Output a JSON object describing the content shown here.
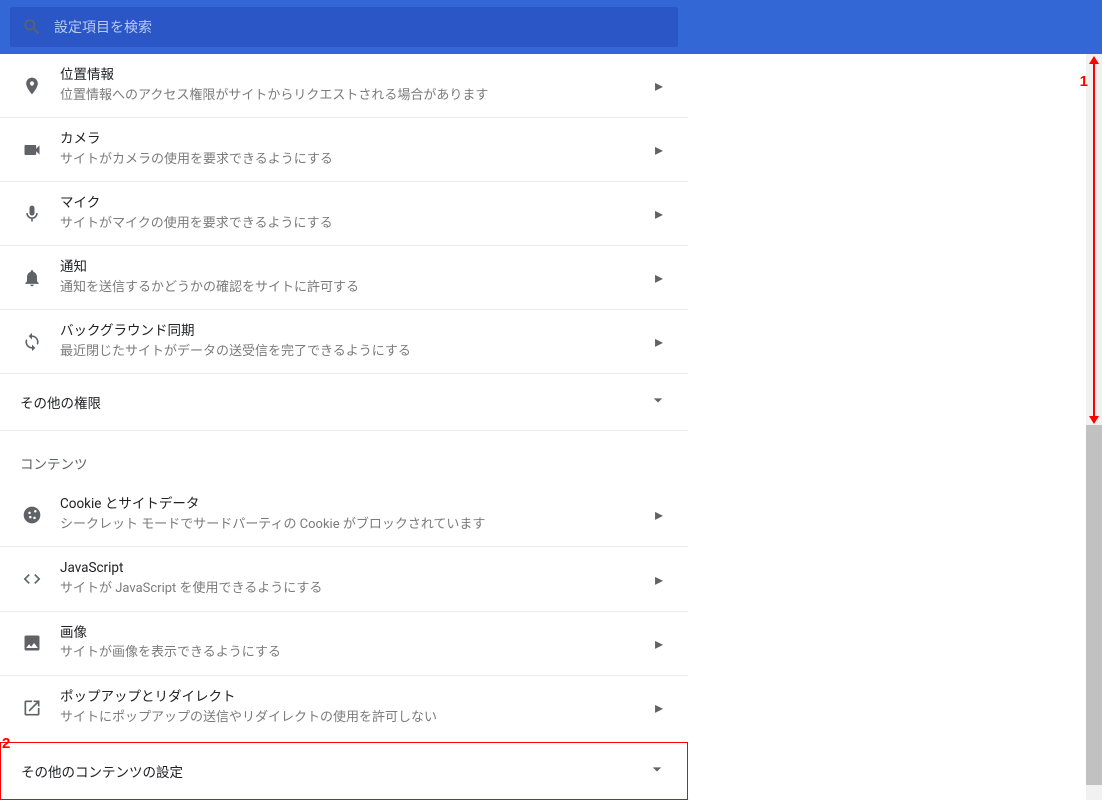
{
  "search": {
    "placeholder": "設定項目を検索"
  },
  "permissions": [
    {
      "icon": "location",
      "title": "位置情報",
      "subtitle": "位置情報へのアクセス権限がサイトからリクエストされる場合があります"
    },
    {
      "icon": "camera",
      "title": "カメラ",
      "subtitle": "サイトがカメラの使用を要求できるようにする"
    },
    {
      "icon": "mic",
      "title": "マイク",
      "subtitle": "サイトがマイクの使用を要求できるようにする"
    },
    {
      "icon": "bell",
      "title": "通知",
      "subtitle": "通知を送信するかどうかの確認をサイトに許可する"
    },
    {
      "icon": "sync",
      "title": "バックグラウンド同期",
      "subtitle": "最近閉じたサイトがデータの送受信を完了できるようにする"
    }
  ],
  "more_permissions_label": "その他の権限",
  "content_section_label": "コンテンツ",
  "content": [
    {
      "icon": "cookie",
      "title": "Cookie とサイトデータ",
      "subtitle": "シークレット モードでサードパーティの Cookie がブロックされています"
    },
    {
      "icon": "code",
      "title": "JavaScript",
      "subtitle": "サイトが JavaScript を使用できるようにする"
    },
    {
      "icon": "image",
      "title": "画像",
      "subtitle": "サイトが画像を表示できるようにする"
    },
    {
      "icon": "popup",
      "title": "ポップアップとリダイレクト",
      "subtitle": "サイトにポップアップの送信やリダイレクトの使用を許可しない"
    }
  ],
  "more_content_label": "その他のコンテンツの設定",
  "annotations": {
    "a1": "1",
    "a2": "2"
  }
}
